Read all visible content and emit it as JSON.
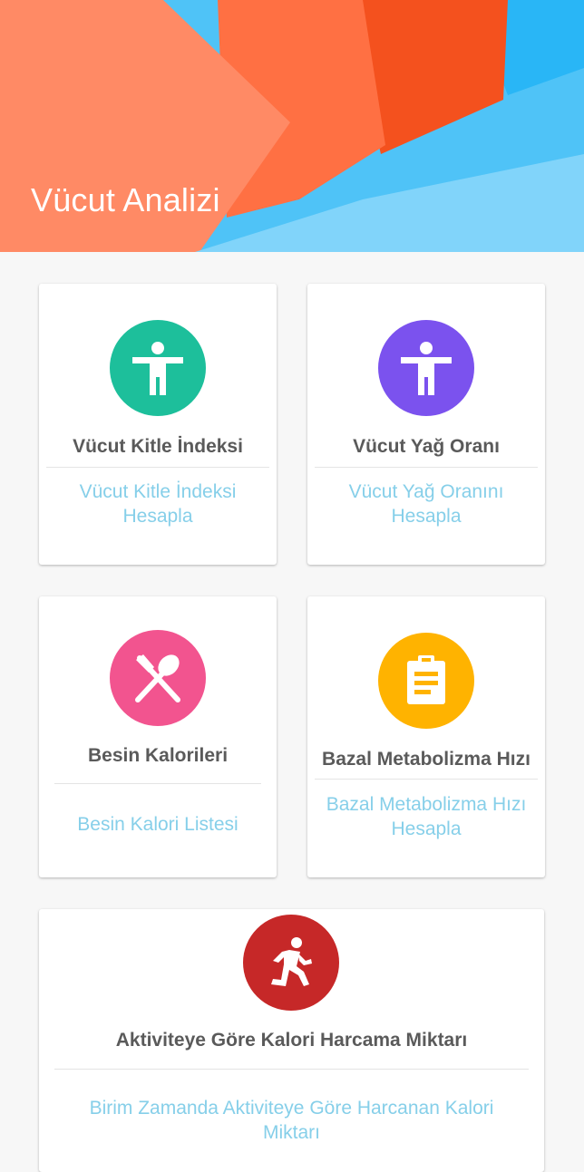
{
  "header": {
    "title": "Vücut Analizi"
  },
  "colors": {
    "bmi_circle": "#1dbf9b",
    "fat_circle": "#7b52ee",
    "food_circle": "#f2548f",
    "bmr_circle": "#ffb300",
    "activity_circle": "#c62828",
    "link": "#86cfe9",
    "title": "#5a5a5a"
  },
  "cards": {
    "bmi": {
      "icon": "accessibility-icon",
      "title": "Vücut Kitle İndeksi",
      "link": "Vücut Kitle İndeksi Hesapla"
    },
    "fat": {
      "icon": "accessibility-icon",
      "title": "Vücut Yağ Oranı",
      "link": "Vücut Yağ Oranını Hesapla"
    },
    "food": {
      "icon": "restaurant-icon",
      "title": "Besin Kalorileri",
      "link": "Besin Kalori Listesi"
    },
    "bmr": {
      "icon": "clipboard-icon",
      "title": "Bazal Metabolizma Hızı",
      "link": "Bazal Metabolizma Hızı Hesapla"
    },
    "activity": {
      "icon": "running-icon",
      "title": "Aktiviteye Göre Kalori Harcama Miktarı",
      "link": "Birim Zamanda Aktiviteye Göre Harcanan Kalori Miktarı"
    }
  }
}
